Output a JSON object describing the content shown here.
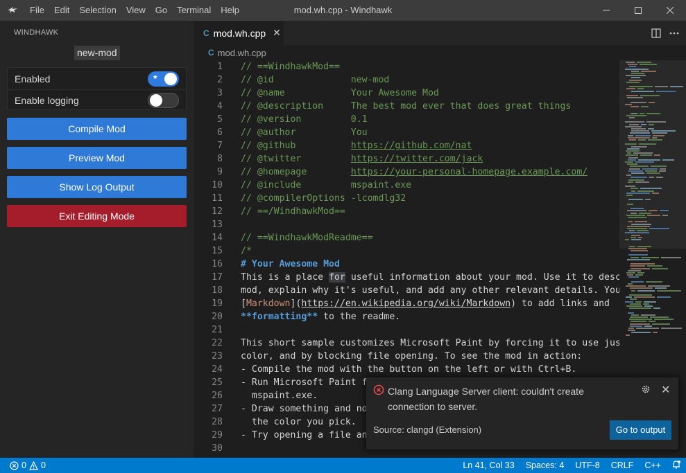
{
  "menu": [
    "File",
    "Edit",
    "Selection",
    "View",
    "Go",
    "Terminal",
    "Help"
  ],
  "window_title": "mod.wh.cpp - Windhawk",
  "sidebar": {
    "title": "WINDHAWK",
    "mod_name": "new-mod",
    "toggles": [
      {
        "label": "Enabled",
        "on": true
      },
      {
        "label": "Enable logging",
        "on": false
      }
    ],
    "buttons": {
      "compile": "Compile Mod",
      "preview": "Preview Mod",
      "show_log": "Show Log Output",
      "exit": "Exit Editing Mode"
    }
  },
  "tab": {
    "label": "mod.wh.cpp",
    "icon": "cpp-file-icon"
  },
  "breadcrumb": {
    "label": "mod.wh.cpp"
  },
  "code": {
    "lines": [
      "// ==WindhawkMod==",
      "// @id              new-mod",
      "// @name            Your Awesome Mod",
      "// @description     The best mod ever that does great things",
      "// @version         0.1",
      "// @author          You",
      "// @github          https://github.com/nat",
      "// @twitter         https://twitter.com/jack",
      "// @homepage        https://your-personal-homepage.example.com/",
      "// @include         mspaint.exe",
      "// @compilerOptions -lcomdlg32",
      "// ==/WindhawkMod==",
      "",
      "// ==WindhawkModReadme==",
      "/*",
      "# Your Awesome Mod",
      "This is a place for useful information about your mod. Use it to describ",
      "mod, explain why it's useful, and add any other relevant details. You ca",
      "[Markdown](https://en.wikipedia.org/wiki/Markdown) to add links and",
      "**formatting** to the readme.",
      "",
      "This short sample customizes Microsoft Paint by forcing it to use just a",
      "color, and by blocking file opening. To see the mod in action:",
      "- Compile the mod with the button on the left or with Ctrl+B.",
      "- Run Microsoft Paint fr",
      "  mspaint.exe.",
      "- Draw something and not",
      "  the color you pick.",
      "- Try opening a file and",
      ""
    ]
  },
  "notification": {
    "message": "Clang Language Server client: couldn't create connection to server.",
    "source": "Source: clangd (Extension)",
    "button": "Go to output"
  },
  "statusbar": {
    "errors": "0",
    "warnings": "0",
    "position": "Ln 41, Col 33",
    "spaces": "Spaces: 4",
    "encoding": "UTF-8",
    "eol": "CRLF",
    "language": "C++"
  },
  "colors": {
    "accent_blue": "#2e7ad6",
    "danger_red": "#a51d2a",
    "status_bar": "#007acc",
    "comment_green": "#6a9955"
  }
}
